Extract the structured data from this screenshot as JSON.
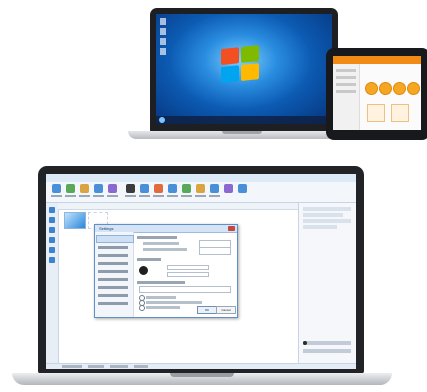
{
  "scene": "device-promo",
  "top_laptop": {
    "os": "windows-7",
    "logo_icon": "windows-logo-icon",
    "colors": {
      "desktop": "#0c5bb3",
      "taskbar": "#0e2144"
    }
  },
  "tablet": {
    "accent": "#f28a16"
  },
  "bottom_laptop": {
    "app": {
      "window_title": "",
      "settings_dialog": {
        "title": "Settings",
        "ok_label": "OK",
        "cancel_label": "Cancel"
      }
    }
  }
}
